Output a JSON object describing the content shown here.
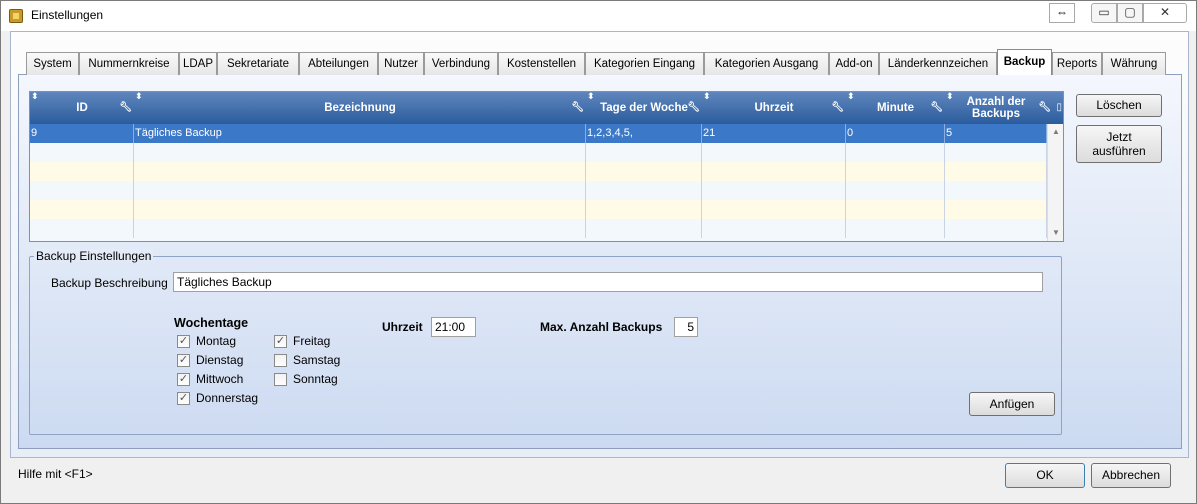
{
  "window": {
    "title": "Einstellungen",
    "controls": {
      "restore_glyph": "⇔",
      "minimize_glyph": "▭",
      "maximize_glyph": "▢",
      "close_glyph": "✕"
    }
  },
  "tabs": [
    {
      "label": "System"
    },
    {
      "label": "Nummernkreise"
    },
    {
      "label": "LDAP"
    },
    {
      "label": "Sekretariate"
    },
    {
      "label": "Abteilungen"
    },
    {
      "label": "Nutzer"
    },
    {
      "label": "Verbindung"
    },
    {
      "label": "Kostenstellen"
    },
    {
      "label": "Kategorien Eingang"
    },
    {
      "label": "Kategorien Ausgang"
    },
    {
      "label": "Add-on"
    },
    {
      "label": "Länderkennzeichen"
    },
    {
      "label": "Backup",
      "active": true
    },
    {
      "label": "Reports"
    },
    {
      "label": "Währung"
    }
  ],
  "grid": {
    "columns": [
      {
        "label": "ID"
      },
      {
        "label": "Bezeichnung"
      },
      {
        "label": "Tage der Woche"
      },
      {
        "label": "Uhrzeit"
      },
      {
        "label": "Minute"
      },
      {
        "label": "Anzahl der Backups"
      }
    ],
    "rows": [
      {
        "id": "9",
        "bezeichnung": "Tägliches Backup",
        "tage": "1,2,3,4,5,",
        "uhrzeit": "21",
        "minute": "0",
        "anzahl": "5",
        "selected": true
      }
    ]
  },
  "side_buttons": {
    "delete_label": "Löschen",
    "run_now_line1": "Jetzt",
    "run_now_line2": "ausführen"
  },
  "backup_settings": {
    "group_title": "Backup Einstellungen",
    "description_label": "Backup Beschreibung",
    "description_value": "Tägliches Backup",
    "weekdays_label": "Wochentage",
    "weekdays": [
      {
        "label": "Montag",
        "checked": true
      },
      {
        "label": "Dienstag",
        "checked": true
      },
      {
        "label": "Mittwoch",
        "checked": true
      },
      {
        "label": "Donnerstag",
        "checked": true
      },
      {
        "label": "Freitag",
        "checked": true
      },
      {
        "label": "Samstag",
        "checked": false
      },
      {
        "label": "Sonntag",
        "checked": false
      }
    ],
    "time_label": "Uhrzeit",
    "time_value": "21:00",
    "max_backups_label": "Max. Anzahl Backups",
    "max_backups_value": "5",
    "add_button_label": "Anfügen"
  },
  "footer": {
    "help_text": "Hilfe mit <F1>",
    "ok_label": "OK",
    "cancel_label": "Abbrechen"
  }
}
